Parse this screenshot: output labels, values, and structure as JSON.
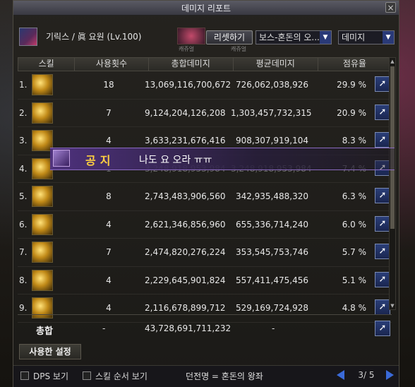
{
  "window": {
    "title": "데미지 리포트",
    "close_label": "×"
  },
  "header": {
    "character": "기릭스 / 眞 요원 (Lv.100)",
    "help_label": "?",
    "thumb_label_1": "캐쥬얼",
    "thumb_label_2": "캐쥬얼",
    "reset_button": "리셋하기",
    "boss_dropdown": "보스-혼돈의 오...",
    "metric_dropdown": "데미지"
  },
  "table": {
    "columns": [
      "스킬",
      "사용횟수",
      "총합데미지",
      "평균데미지",
      "점유율"
    ],
    "rows": [
      {
        "rank": "1.",
        "count": "18",
        "total": "13,069,116,700,672",
        "avg": "726,062,038,926",
        "share": "29.9 %",
        "icon": "skill-icon"
      },
      {
        "rank": "2.",
        "count": "7",
        "total": "9,124,204,126,208",
        "avg": "1,303,457,732,315",
        "share": "20.9 %",
        "icon": "skill-icon"
      },
      {
        "rank": "3.",
        "count": "4",
        "total": "3,633,231,676,416",
        "avg": "908,307,919,104",
        "share": "8.3 %",
        "icon": "skill-icon"
      },
      {
        "rank": "4.",
        "count": "1",
        "total": "3,248,918,953,984",
        "avg": "3,248,918,953,984",
        "share": "7.4 %",
        "icon": "skill-icon"
      },
      {
        "rank": "5.",
        "count": "8",
        "total": "2,743,483,906,560",
        "avg": "342,935,488,320",
        "share": "6.3 %",
        "icon": "skill-icon"
      },
      {
        "rank": "6.",
        "count": "4",
        "total": "2,621,346,856,960",
        "avg": "655,336,714,240",
        "share": "6.0 %",
        "icon": "skill-icon"
      },
      {
        "rank": "7.",
        "count": "7",
        "total": "2,474,820,276,224",
        "avg": "353,545,753,746",
        "share": "5.7 %",
        "icon": "skill-icon"
      },
      {
        "rank": "8.",
        "count": "4",
        "total": "2,229,645,901,824",
        "avg": "557,411,475,456",
        "share": "5.1 %",
        "icon": "skill-icon"
      },
      {
        "rank": "9.",
        "count": "4",
        "total": "2,116,678,899,712",
        "avg": "529,169,724,928",
        "share": "4.8 %",
        "icon": "skill-icon"
      }
    ],
    "share_icon": "share-icon"
  },
  "notice": {
    "label": "공지",
    "text": "나도 요 오라 ㅠㅠ"
  },
  "total": {
    "label": "총합",
    "count": "-",
    "value": "43,728,691,711,232",
    "avg": "-"
  },
  "settings_tab": "사용한 설정",
  "bottom": {
    "dps_label": "DPS 보기",
    "order_label": "스킬 순서 보기",
    "dungeon": "던전명 = 혼돈의 왕좌",
    "page": "3/ 5"
  },
  "colors": {
    "accent": "#2a3e78",
    "notice_gold": "#ffd040",
    "notice_bg": "#50328a"
  }
}
